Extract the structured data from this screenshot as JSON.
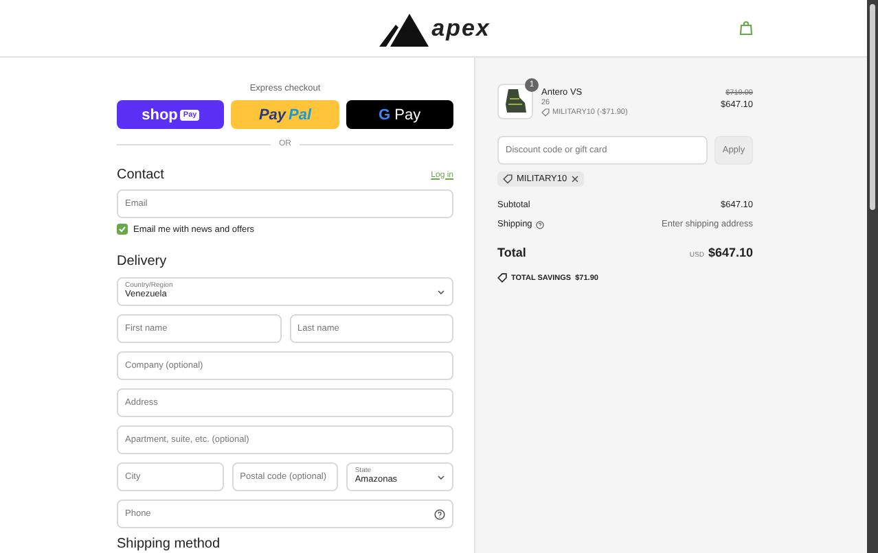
{
  "header": {
    "logo_text": "apex"
  },
  "express_checkout": {
    "label": "Express checkout",
    "buttons": [
      {
        "kind": "shop_pay",
        "text": "shop",
        "badge": "Pay"
      },
      {
        "kind": "paypal",
        "text": "Pay",
        "text2": "Pal"
      },
      {
        "kind": "gpay",
        "text": "G",
        "text2": "Pay"
      }
    ],
    "divider": "OR"
  },
  "contact": {
    "title": "Contact",
    "login_link": "Log in",
    "email": {
      "placeholder": "Email"
    },
    "newsletter": {
      "label": "Email me with news and offers",
      "checked": true
    }
  },
  "delivery": {
    "title": "Delivery",
    "rows": [
      [
        {
          "kind": "select",
          "label": "Country/Region",
          "value": "Venezuela"
        }
      ],
      [
        {
          "kind": "text",
          "placeholder": "First name"
        },
        {
          "kind": "text",
          "placeholder": "Last name"
        }
      ],
      [
        {
          "kind": "text",
          "placeholder": "Company (optional)"
        }
      ],
      [
        {
          "kind": "text",
          "placeholder": "Address"
        }
      ],
      [
        {
          "kind": "text",
          "placeholder": "Apartment, suite, etc. (optional)"
        }
      ],
      [
        {
          "kind": "text",
          "placeholder": "City"
        },
        {
          "kind": "text",
          "placeholder": "Postal code (optional)"
        },
        {
          "kind": "select",
          "label": "State",
          "value": "Amazonas"
        }
      ],
      [
        {
          "kind": "help",
          "placeholder": "Phone"
        }
      ]
    ]
  },
  "shipping_method": {
    "title": "Shipping method"
  },
  "summary": {
    "item": {
      "name": "Antero VS",
      "quantity": "1",
      "variant": "26",
      "discount": "MILITARY10 (-$71.90)",
      "original_price": "$719.00",
      "price": "$647.10"
    },
    "discount_field": {
      "placeholder": "Discount code or gift card"
    },
    "apply_button": "Apply",
    "applied_code": "MILITARY10",
    "lines": [
      {
        "label": "Subtotal",
        "value": "$647.10",
        "help": false
      },
      {
        "label": "Shipping",
        "value": "Enter shipping address",
        "help": true
      }
    ],
    "total": {
      "label": "Total",
      "currency": "USD",
      "value": "$647.10"
    },
    "savings": {
      "label": "TOTAL SAVINGS",
      "value": "$71.90"
    }
  }
}
